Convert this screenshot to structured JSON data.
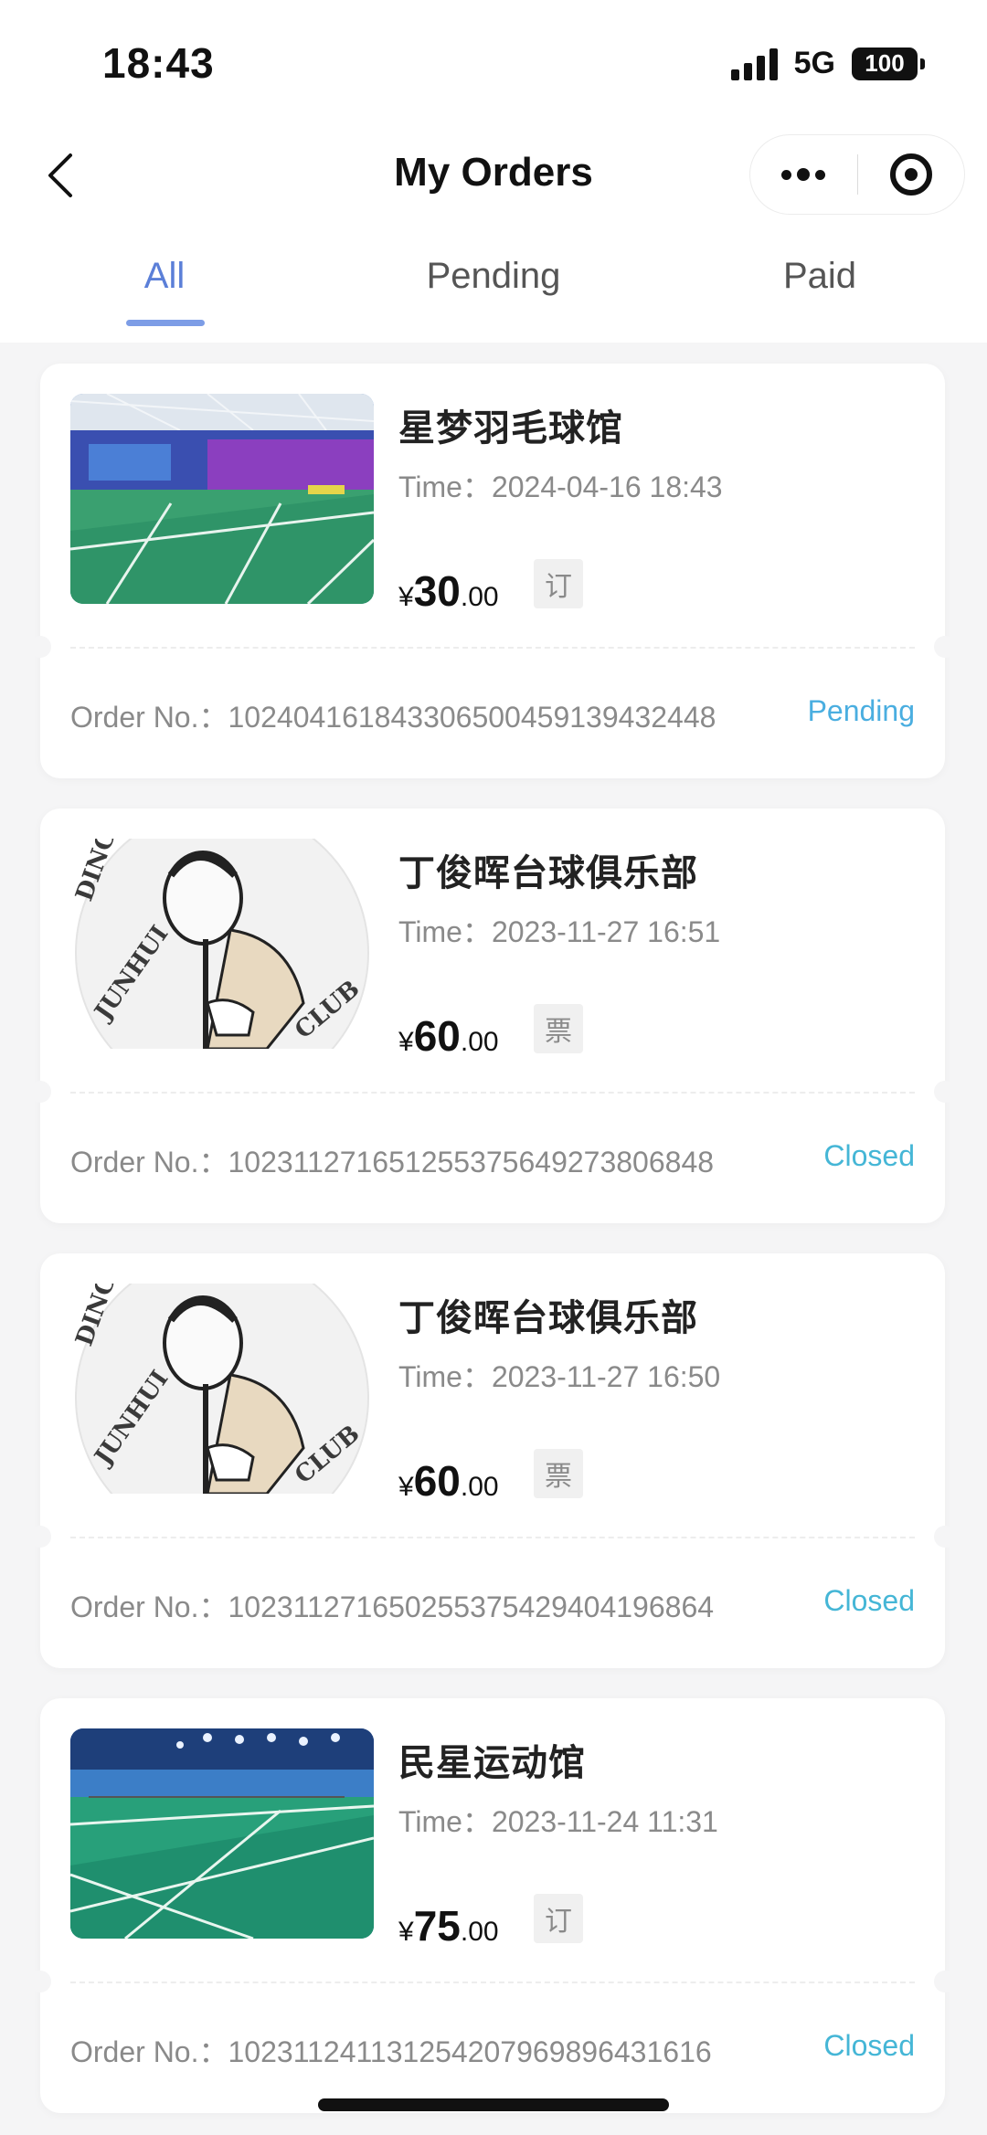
{
  "status_bar": {
    "time": "18:43",
    "network": "5G",
    "battery": "100"
  },
  "nav": {
    "title": "My Orders",
    "back_icon": "chevron-left-icon",
    "more_icon": "more-dots-icon",
    "close_icon": "target-circle-icon"
  },
  "tabs": [
    {
      "label": "All",
      "active": true
    },
    {
      "label": "Pending",
      "active": false
    },
    {
      "label": "Paid",
      "active": false
    }
  ],
  "colors": {
    "accent": "#5b7fd8",
    "status": "#45b6d6",
    "muted": "#8a8a8a"
  },
  "orders": [
    {
      "venue": "星梦羽毛球馆",
      "time_label": "Time：",
      "time": "2024-04-16 18:43",
      "currency": "¥",
      "price_int": "30",
      "price_dec": ".00",
      "tag": "订",
      "order_label": "Order No.：",
      "order_no": "10240416184330650045913943244 8",
      "status": "Pending",
      "image": "badminton-hall-purple"
    },
    {
      "venue": "丁俊晖台球俱乐部",
      "time_label": "Time：",
      "time": "2023-11-27 16:51",
      "currency": "¥",
      "price_int": "60",
      "price_dec": ".00",
      "tag": "票",
      "order_label": "Order No.：",
      "order_no": "1023112716512553756492738068 48",
      "status": "Closed",
      "image": "billiards-club-logo"
    },
    {
      "venue": "丁俊晖台球俱乐部",
      "time_label": "Time：",
      "time": "2023-11-27 16:50",
      "currency": "¥",
      "price_int": "60",
      "price_dec": ".00",
      "tag": "票",
      "order_label": "Order No.：",
      "order_no": "102311271650255375429404196864",
      "status": "Closed",
      "image": "billiards-club-logo"
    },
    {
      "venue": "民星运动馆",
      "time_label": "Time：",
      "time": "2023-11-24 11:31",
      "currency": "¥",
      "price_int": "75",
      "price_dec": ".00",
      "tag": "订",
      "order_label": "Order No.：",
      "order_no": "102311241131254207969896431616",
      "status": "Closed",
      "image": "badminton-hall-green"
    }
  ]
}
